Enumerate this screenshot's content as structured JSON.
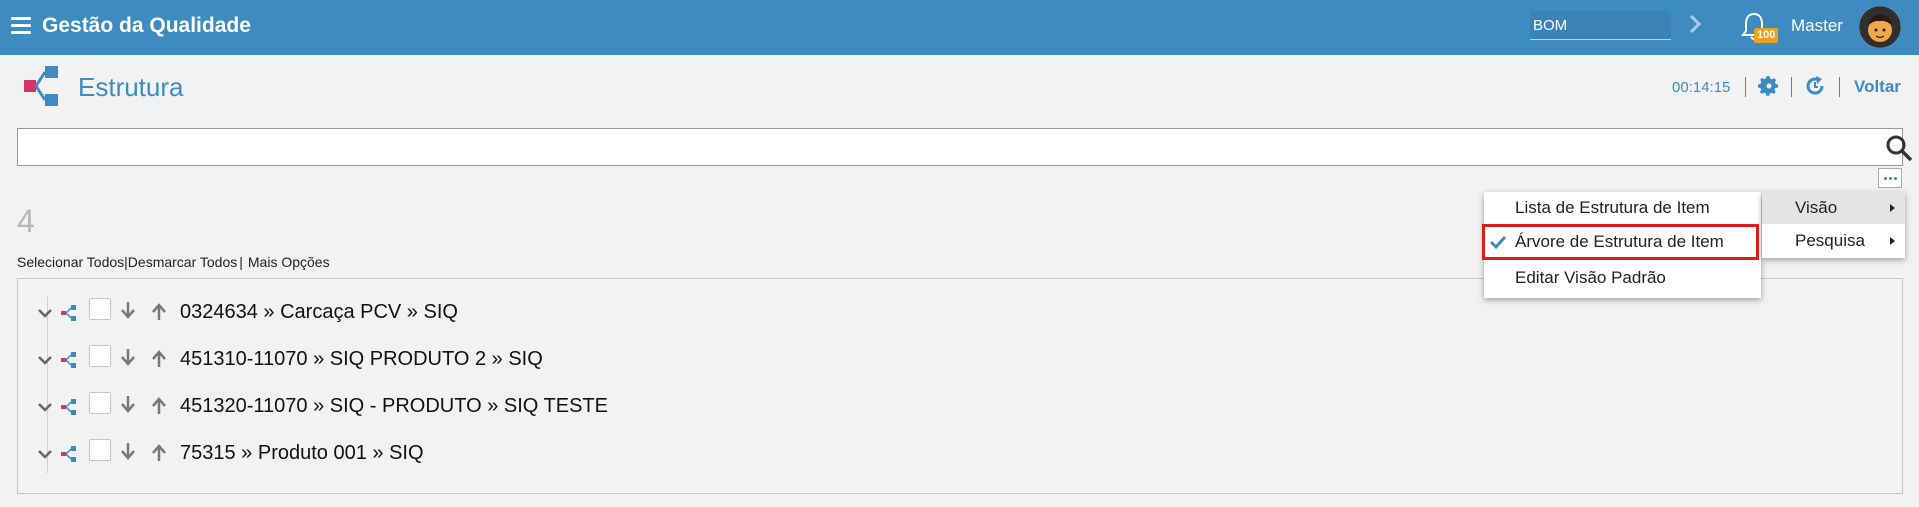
{
  "header": {
    "app_title": "Gestão da Qualidade",
    "search_value": "BOM",
    "notification_count": "100",
    "user_name": "Master"
  },
  "page": {
    "title": "Estrutura",
    "timer": "00:14:15",
    "back_label": "Voltar"
  },
  "search": {
    "value": "",
    "placeholder": ""
  },
  "results": {
    "count": "4",
    "select_all": "Selecionar Todos",
    "deselect_all": "Desmarcar Todos",
    "more_options": "Mais Opções",
    "items": [
      {
        "label": "0324634 » Carcaça PCV » SIQ"
      },
      {
        "label": "451310-11070 » SIQ PRODUTO 2 » SIQ"
      },
      {
        "label": "451320-11070 » SIQ - PRODUTO » SIQ TESTE"
      },
      {
        "label": "75315 » Produto 001 » SIQ"
      }
    ]
  },
  "context_menu": {
    "items": [
      {
        "label": "Visão",
        "active": true
      },
      {
        "label": "Pesquisa",
        "active": false
      }
    ],
    "submenu": [
      {
        "label": "Lista de Estrutura de Item",
        "checked": false
      },
      {
        "label": "Árvore de Estrutura de Item",
        "checked": true
      },
      {
        "label": "Editar Visão Padrão",
        "checked": false
      }
    ]
  },
  "colors": {
    "header_bg": "#3d8bc0",
    "accent": "#3d8bc0",
    "badge": "#f0a020",
    "highlight_border": "#e01b1b",
    "tree_icon_blue": "#3d8bc0",
    "tree_icon_red": "#d6336c"
  },
  "icons": [
    "menu-icon",
    "chevron-right-icon",
    "bell-icon",
    "structure-icon",
    "gear-icon",
    "refresh-icon",
    "search-icon",
    "more-icon",
    "expand-icon",
    "tree-icon",
    "arrow-down-icon",
    "arrow-up-icon",
    "check-icon",
    "caret-right-icon"
  ]
}
